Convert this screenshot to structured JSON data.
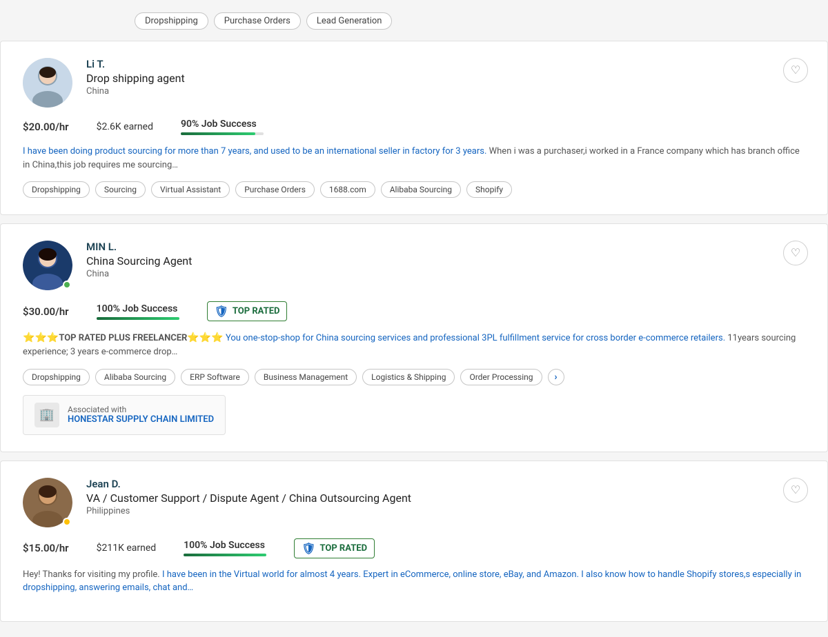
{
  "topTags": [
    {
      "label": "Dropshipping"
    },
    {
      "label": "Purchase Orders"
    },
    {
      "label": "Lead Generation"
    }
  ],
  "freelancers": [
    {
      "id": "li-t",
      "name": "Li T.",
      "title": "Drop shipping agent",
      "country": "China",
      "rate": "$20.00/hr",
      "earned": "$2.6K earned",
      "jobSuccess": "90% Job Success",
      "jobSuccessPercent": 90,
      "topRated": false,
      "online": false,
      "dotColor": "none",
      "description": "I have been doing product sourcing for more than 7 years, and used to be an international seller in factory for 3 years. When i was a purchaser,i worked in a France company which has branch office in China,this job requires me sourcing…",
      "descriptionHighlight": "I have been doing product sourcing for more than 7 years, and used to be an international seller in factory for 3 years.",
      "skills": [
        "Dropshipping",
        "Sourcing",
        "Virtual Assistant",
        "Purchase Orders",
        "1688.com",
        "Alibaba Sourcing",
        "Shopify"
      ],
      "company": null
    },
    {
      "id": "min-l",
      "name": "MIN L.",
      "title": "China Sourcing Agent",
      "country": "China",
      "rate": "$30.00/hr",
      "earned": null,
      "jobSuccess": "100% Job Success",
      "jobSuccessPercent": 100,
      "topRated": true,
      "online": true,
      "dotColor": "green",
      "description": "⭐⭐⭐TOP RATED PLUS FREELANCER⭐⭐⭐ You one-stop-shop for China sourcing services and professional 3PL fulfillment service for cross border e-commerce retailers. 11years sourcing experience; 3 years e-commerce drop…",
      "skills": [
        "Dropshipping",
        "Alibaba Sourcing",
        "ERP Software",
        "Business Management",
        "Logistics & Shipping",
        "Order Processing"
      ],
      "hasMore": true,
      "company": {
        "label": "Associated with",
        "name": "HONESTAR SUPPLY CHAIN LIMITED"
      }
    },
    {
      "id": "jean-d",
      "name": "Jean D.",
      "title": "VA / Customer Support / Dispute Agent / China Outsourcing Agent",
      "country": "Philippines",
      "rate": "$15.00/hr",
      "earned": "$211K earned",
      "jobSuccess": "100% Job Success",
      "jobSuccessPercent": 100,
      "topRated": true,
      "online": true,
      "dotColor": "yellow",
      "description": "Hey! Thanks for visiting my profile. I have been in the Virtual world for almost 4 years. Expert in eCommerce, online store, eBay, and Amazon. I also know how to handle Shopify stores,s especially in dropshipping, answering emails, chat and…",
      "skills": [],
      "company": null
    }
  ],
  "labels": {
    "topRated": "TOP RATED",
    "associatedWith": "Associated with"
  }
}
